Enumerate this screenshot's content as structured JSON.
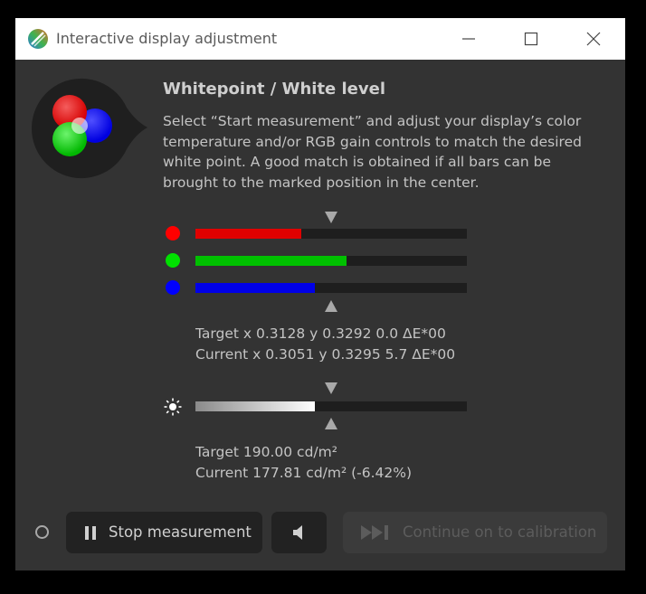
{
  "window": {
    "title": "Interactive display adjustment"
  },
  "content": {
    "heading": "Whitepoint / White level",
    "description": "Select “Start measurement” and adjust your display’s color temperature and/or RGB gain controls to match the desired white point. A good match is obtained if all bars can be brought to the marked position in the center."
  },
  "rgb_bars": [
    {
      "channel": "red",
      "color": "#ff0000",
      "fill_color": "#e00000",
      "level": 0.39
    },
    {
      "channel": "green",
      "color": "#00e000",
      "fill_color": "#00c000",
      "level": 0.555
    },
    {
      "channel": "blue",
      "color": "#0000ff",
      "fill_color": "#0000e8",
      "level": 0.44
    }
  ],
  "whitepoint": {
    "target": "Target x 0.3128 y 0.3292 0.0 ΔE*00",
    "current": "Current x 0.3051 y 0.3295 5.7 ΔE*00"
  },
  "luminance_bar": {
    "level": 0.44
  },
  "luminance": {
    "target": "Target 190.00 cd/m²",
    "current": "Current 177.81 cd/m² (-6.42%)"
  },
  "buttons": {
    "stop_label": "Stop measurement",
    "continue_label": "Continue on to calibration"
  },
  "icons": {
    "app": "rgb-circles-icon",
    "brightness": "sun-icon",
    "pause": "pause-icon",
    "sound": "speaker-icon",
    "skip": "skip-forward-icon"
  }
}
